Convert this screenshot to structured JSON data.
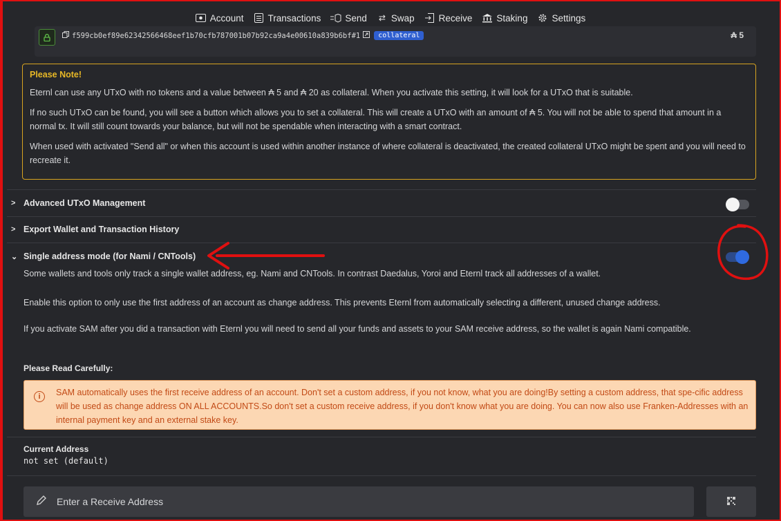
{
  "nav": {
    "items": [
      {
        "label": "Account",
        "icon": "wallet-icon"
      },
      {
        "label": "Transactions",
        "icon": "list-icon"
      },
      {
        "label": "Send",
        "icon": "send-icon"
      },
      {
        "label": "Swap",
        "icon": "swap-icon"
      },
      {
        "label": "Receive",
        "icon": "receive-icon"
      },
      {
        "label": "Staking",
        "icon": "bank-icon"
      },
      {
        "label": "Settings",
        "icon": "gear-icon"
      }
    ],
    "active": "Settings"
  },
  "collateral": {
    "hash": "f599cb0ef89e62342566468eef1b70cfb787001b07b92ca9a4e00610a839b6bf#1",
    "badge": "collateral",
    "amount": "₳ 5"
  },
  "note": {
    "title": "Please Note!",
    "paragraphs": [
      "Eternl can use any UTxO with no tokens and a value between ₳ 5 and ₳ 20 as collateral. When you activate this setting, it will look for a UTxO that is suitable.",
      "If no such UTxO can be found, you will see a button which allows you to set a collateral. This will create a UTxO with an amount of ₳ 5. You will not be able to spend that amount in a normal tx. It will still count towards your balance, but will not be spendable when interacting with a smart contract.",
      "When used with activated \"Send all\" or when this account is used within another instance of where collateral is deactivated, the created collateral UTxO might be spent and you will need to recreate it."
    ]
  },
  "sections": {
    "advanced": {
      "label": "Advanced UTxO Management",
      "toggle": "off"
    },
    "export": {
      "label": "Export Wallet and Transaction History"
    },
    "sam": {
      "label": "Single address mode (for Nami / CNTools)",
      "toggle": "on"
    }
  },
  "sam": {
    "p1": "Some wallets and tools only track a single wallet address, eg. Nami and CNTools. In contrast Daedalus, Yoroi and Eternl track all addresses of a wallet.",
    "p2": "Enable this option to only use the first address of an account as change address. This prevents Eternl from automatically selecting a different, unused change address.",
    "p3": "If you activate SAM after you did a transaction with Eternl you will need to send all your funds and assets to your SAM receive address, so the wallet is again Nami compatible.",
    "read_title": "Please Read Carefully:",
    "warning": "SAM automatically uses the first receive address of an account. Don't set a custom address, if you not know, what you are doing!By setting a custom address, that spe-cific address will be used as change address ON ALL ACCOUNTS.So don't set a custom receive address, if you don't know what you are doing. You can now also use Franken-Addresses with an internal payment key and an external stake key.",
    "current_label": "Current Address",
    "current_value": "not set (default)",
    "input_placeholder": "Enter a Receive Address"
  },
  "colors": {
    "frame": "#e01010",
    "note_border": "#d9a520",
    "toggle_on": "#2f6ae0",
    "warning_bg": "#fcd7b3",
    "annotation": "#e01010"
  }
}
